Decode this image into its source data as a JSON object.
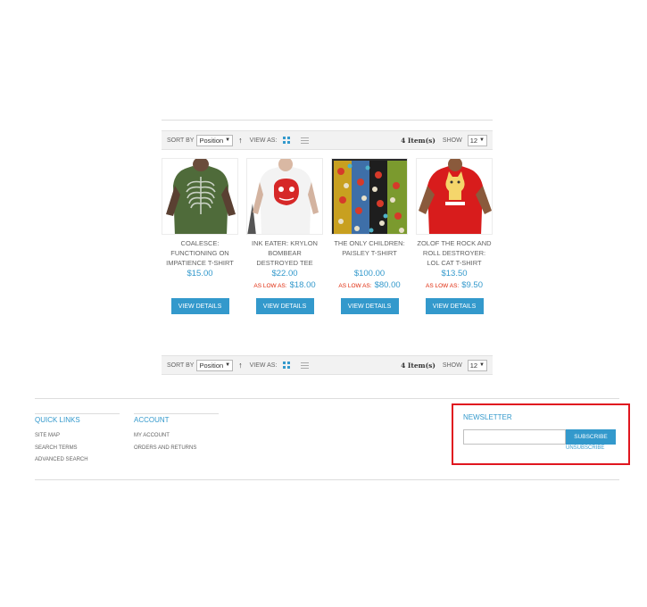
{
  "toolbar": {
    "sort_label": "Sort By",
    "sort_value": "Position",
    "view_label": "View as:",
    "item_count": "4 Item(s)",
    "show_label": "Show",
    "show_value": "12"
  },
  "products": [
    {
      "name": "Coalesce: Functioning On Impatience T-Shirt",
      "price": "$15.00",
      "as_low_as_label": "",
      "as_low_as_price": "",
      "button": "View Details",
      "image_icon": "green-skeleton-tshirt"
    },
    {
      "name": "Ink Eater: Krylon Bombear Destroyed Tee",
      "price": "$22.00",
      "as_low_as_label": "As low as:",
      "as_low_as_price": "$18.00",
      "button": "View Details",
      "image_icon": "white-red-bear-tshirt"
    },
    {
      "name": "The Only Children: Paisley T-Shirt",
      "price": "$100.00",
      "as_low_as_label": "As low as:",
      "as_low_as_price": "$80.00",
      "button": "View Details",
      "image_icon": "paisley-tshirts-stack"
    },
    {
      "name": "Zolof The Rock And Roll Destroyer: LOL Cat T-shirt",
      "price": "$13.50",
      "as_low_as_label": "As low as:",
      "as_low_as_price": "$9.50",
      "button": "View Details",
      "image_icon": "red-cat-tshirt"
    }
  ],
  "footer": {
    "quick_links": {
      "title": "Quick Links",
      "links": [
        "Site Map",
        "Search Terms",
        "Advanced Search"
      ]
    },
    "account": {
      "title": "Account",
      "links": [
        "My Account",
        "Orders and Returns"
      ]
    },
    "newsletter": {
      "title": "Newsletter",
      "input_value": "",
      "subscribe_label": "Subscribe",
      "unsubscribe_label": "Unsubscribe"
    }
  },
  "colors": {
    "accent": "#3399cc",
    "highlight_border": "#e0161f",
    "as_low_as": "#df280a"
  }
}
